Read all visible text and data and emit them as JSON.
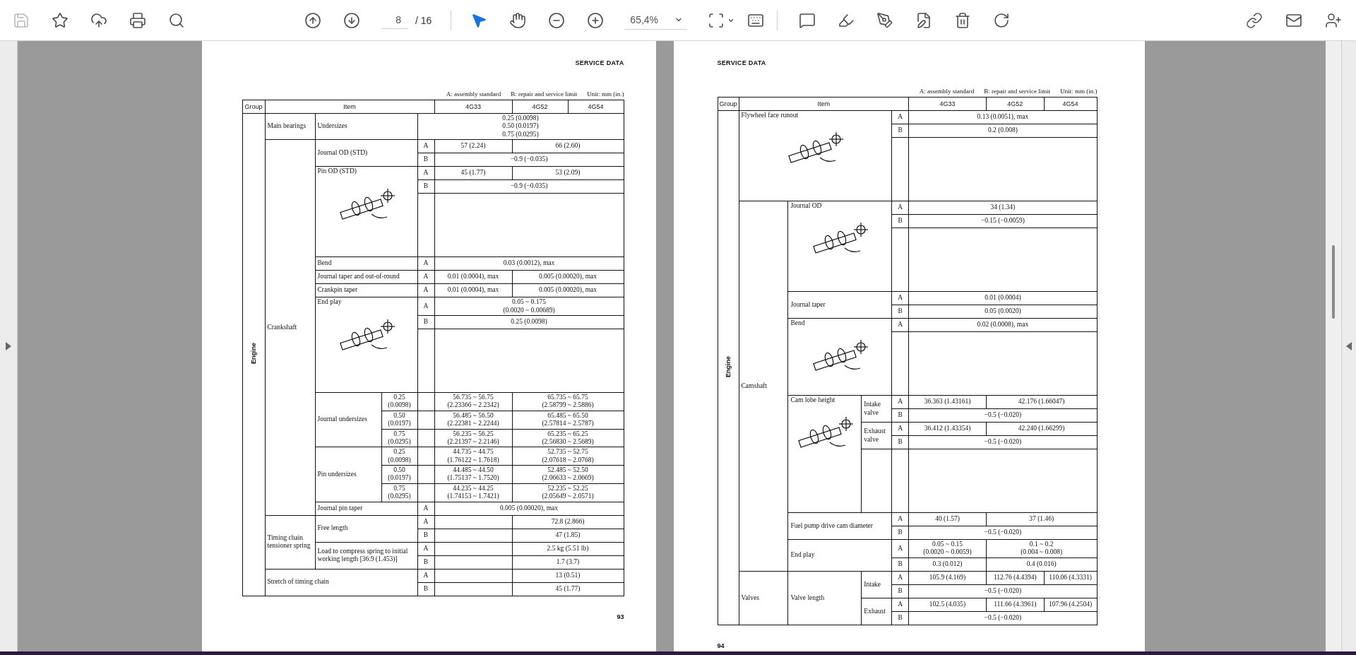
{
  "toolbar": {
    "file_tools": [
      {
        "kind": "save",
        "disabled": true
      },
      {
        "kind": "star",
        "disabled": false
      },
      {
        "kind": "upload",
        "disabled": false
      },
      {
        "kind": "print",
        "disabled": false
      },
      {
        "kind": "search",
        "disabled": false
      }
    ],
    "page_input": "8",
    "page_count": "/ 16",
    "modes": [
      {
        "kind": "pointer",
        "selected": true
      },
      {
        "kind": "hand",
        "selected": false
      }
    ],
    "zoom": "65,4%"
  },
  "pages": [
    {
      "kind": "verso",
      "header": "SERVICE DATA",
      "legend": [
        "A: assembly standard",
        "B: repair and service limit",
        "Unit: mm (in.)"
      ],
      "page_number": "93",
      "table": [
        {
          "kind": "line",
          "cells": [
            {
              "kind": "header",
              "text": "Group"
            },
            {
              "kind": "header",
              "text": "Item",
              "colspan": 4
            },
            {
              "kind": "header",
              "text": "4G33"
            },
            {
              "kind": "header",
              "text": "4G52"
            },
            {
              "kind": "header",
              "text": "4G54"
            }
          ]
        },
        {
          "kind": "line",
          "cells": [
            {
              "kind": "group",
              "text": "Engine",
              "rowspan": 25
            },
            {
              "kind": "section",
              "text": "Main bearings"
            },
            {
              "kind": "label",
              "text": "Undersizes",
              "colspan": 2
            },
            {
              "kind": "value",
              "text": "0.25 (0.0098)\n0.50 (0.0197)\n0.75 (0.0295)",
              "colspan": 4
            }
          ]
        },
        {
          "kind": "line",
          "cells": [
            {
              "kind": "section",
              "text": "Crankshaft",
              "rowspan": 18
            },
            {
              "kind": "label",
              "text": "Journal OD (STD)",
              "colspan": 2,
              "rowspan": 2
            },
            {
              "kind": "ab",
              "text": "A"
            },
            {
              "kind": "value",
              "text": "57 (2.24)"
            },
            {
              "kind": "value",
              "text": "66 (2.60)",
              "colspan": 2
            }
          ]
        },
        {
          "kind": "line",
          "cells": [
            {
              "kind": "ab",
              "text": "B"
            },
            {
              "kind": "value",
              "text": "−0.9 (−0.035)",
              "colspan": 3
            }
          ]
        },
        {
          "kind": "line",
          "cells": [
            {
              "kind": "label",
              "text": "Pin OD (STD)",
              "colspan": 2,
              "rowspan": 3,
              "figure": true
            },
            {
              "kind": "ab",
              "text": "A"
            },
            {
              "kind": "value",
              "text": "45 (1.77)"
            },
            {
              "kind": "value",
              "text": "53 (2.09)",
              "colspan": 2
            }
          ]
        },
        {
          "kind": "line",
          "cells": [
            {
              "kind": "ab",
              "text": "B"
            },
            {
              "kind": "value",
              "text": "−0.9 (−0.035)",
              "colspan": 3
            }
          ]
        },
        {
          "kind": "gap",
          "cells": [
            {
              "kind": "empty"
            },
            {
              "kind": "empty",
              "colspan": 3
            }
          ]
        },
        {
          "kind": "line",
          "cells": [
            {
              "kind": "label",
              "text": "Bend",
              "colspan": 2
            },
            {
              "kind": "ab",
              "text": "A"
            },
            {
              "kind": "value",
              "text": "0.03 (0.0012), max",
              "colspan": 3
            }
          ]
        },
        {
          "kind": "line",
          "cells": [
            {
              "kind": "label",
              "text": "Journal taper and out-of-round",
              "colspan": 2
            },
            {
              "kind": "ab",
              "text": "A"
            },
            {
              "kind": "value",
              "text": "0.01 (0.0004), max"
            },
            {
              "kind": "value",
              "text": "0.005 (0.00020), max",
              "colspan": 2
            }
          ]
        },
        {
          "kind": "line",
          "cells": [
            {
              "kind": "label",
              "text": "Crankpin taper",
              "colspan": 2
            },
            {
              "kind": "ab",
              "text": "A"
            },
            {
              "kind": "value",
              "text": "0.01 (0.0004), max"
            },
            {
              "kind": "value",
              "text": "0.005 (0.00020), max",
              "colspan": 2
            }
          ]
        },
        {
          "kind": "line",
          "cells": [
            {
              "kind": "label",
              "text": "End play",
              "colspan": 2,
              "rowspan": 3,
              "figure": true
            },
            {
              "kind": "ab",
              "text": "A"
            },
            {
              "kind": "value",
              "text": "0.05 ~ 0.175\n(0.0020 ~ 0.00689)",
              "colspan": 3
            }
          ]
        },
        {
          "kind": "line",
          "cells": [
            {
              "kind": "ab",
              "text": "B"
            },
            {
              "kind": "value",
              "text": "0.25 (0.0098)",
              "colspan": 3
            }
          ]
        },
        {
          "kind": "gap",
          "cells": [
            {
              "kind": "empty"
            },
            {
              "kind": "empty",
              "colspan": 3
            }
          ]
        },
        {
          "kind": "line",
          "cells": [
            {
              "kind": "label",
              "text": "Journal undersizes",
              "rowspan": 3
            },
            {
              "kind": "size",
              "text": "0.25\n(0.0098)"
            },
            {
              "kind": "empty"
            },
            {
              "kind": "value",
              "text": "56.735 ~ 56.75\n(2.23366 ~ 2.2342)"
            },
            {
              "kind": "value",
              "text": "65.735 ~ 65.75\n(2.58799 ~ 2.5886)",
              "colspan": 2
            }
          ]
        },
        {
          "kind": "line",
          "cells": [
            {
              "kind": "size",
              "text": "0.50\n(0.0197)"
            },
            {
              "kind": "empty"
            },
            {
              "kind": "value",
              "text": "56.485 ~ 56.50\n(2.22381 ~ 2.2244)"
            },
            {
              "kind": "value",
              "text": "65.485 ~ 65.50\n(2.57814 ~ 2.5787)",
              "colspan": 2
            }
          ]
        },
        {
          "kind": "line",
          "cells": [
            {
              "kind": "size",
              "text": "0.75\n(0.0295)"
            },
            {
              "kind": "empty"
            },
            {
              "kind": "value",
              "text": "56.235 ~ 56.25\n(2.21397 ~ 2.2146)"
            },
            {
              "kind": "value",
              "text": "65.235 ~ 65.25\n(2.56830 ~ 2.5689)",
              "colspan": 2
            }
          ]
        },
        {
          "kind": "line",
          "cells": [
            {
              "kind": "label",
              "text": "Pin undersizes",
              "rowspan": 3
            },
            {
              "kind": "size",
              "text": "0.25\n(0.0098)"
            },
            {
              "kind": "empty"
            },
            {
              "kind": "value",
              "text": "44.735 ~ 44.75\n(1.76122 ~ 1.7618)"
            },
            {
              "kind": "value",
              "text": "52.735 ~ 52.75\n(2.07618 ~ 2.0768)",
              "colspan": 2
            }
          ]
        },
        {
          "kind": "line",
          "cells": [
            {
              "kind": "size",
              "text": "0.50\n(0.0197)"
            },
            {
              "kind": "empty"
            },
            {
              "kind": "value",
              "text": "44.485 ~ 44.50\n(1.75137 ~ 1.7520)"
            },
            {
              "kind": "value",
              "text": "52.485 ~ 52.50\n(2.06633 ~ 2.0669)",
              "colspan": 2
            }
          ]
        },
        {
          "kind": "line",
          "cells": [
            {
              "kind": "size",
              "text": "0.75\n(0.0295)"
            },
            {
              "kind": "empty"
            },
            {
              "kind": "value",
              "text": "44.235 ~ 44.25\n(1.74153 ~ 1.7421)"
            },
            {
              "kind": "value",
              "text": "52.235 ~ 52.25\n(2.05649 ~ 2.0571)",
              "colspan": 2
            }
          ]
        },
        {
          "kind": "line",
          "cells": [
            {
              "kind": "label",
              "text": "Journal pin taper",
              "colspan": 2
            },
            {
              "kind": "ab",
              "text": "A"
            },
            {
              "kind": "value",
              "text": "0.005 (0.00020), max",
              "colspan": 3
            }
          ]
        },
        {
          "kind": "line",
          "cells": [
            {
              "kind": "section",
              "text": "Timing chain tensioner spring",
              "rowspan": 4
            },
            {
              "kind": "label",
              "text": "Free length",
              "colspan": 2,
              "rowspan": 2
            },
            {
              "kind": "ab",
              "text": "A"
            },
            {
              "kind": "empty"
            },
            {
              "kind": "value",
              "text": "72.8 (2.866)",
              "colspan": 2
            }
          ]
        },
        {
          "kind": "line",
          "cells": [
            {
              "kind": "ab",
              "text": "B"
            },
            {
              "kind": "empty"
            },
            {
              "kind": "value",
              "text": "47 (1.85)",
              "colspan": 2
            }
          ]
        },
        {
          "kind": "line",
          "cells": [
            {
              "kind": "label",
              "text": "Load to compress spring to initial working length [36.9 (1.453)]",
              "colspan": 2,
              "rowspan": 2
            },
            {
              "kind": "ab",
              "text": "A"
            },
            {
              "kind": "empty"
            },
            {
              "kind": "value",
              "text": "2.5 kg (5.51 lb)",
              "colspan": 2
            }
          ]
        },
        {
          "kind": "line",
          "cells": [
            {
              "kind": "ab",
              "text": "B"
            },
            {
              "kind": "empty"
            },
            {
              "kind": "value",
              "text": "1.7 (3.7)",
              "colspan": 2
            }
          ]
        },
        {
          "kind": "line",
          "cells": [
            {
              "kind": "section",
              "text": "Stretch of timing chain",
              "colspan": 3,
              "rowspan": 2
            },
            {
              "kind": "ab",
              "text": "A"
            },
            {
              "kind": "empty"
            },
            {
              "kind": "value",
              "text": "13 (0.51)",
              "colspan": 2
            }
          ]
        },
        {
          "kind": "line",
          "cells": [
            {
              "kind": "ab",
              "text": "B"
            },
            {
              "kind": "empty"
            },
            {
              "kind": "value",
              "text": "45 (1.77)",
              "colspan": 2
            }
          ]
        }
      ]
    },
    {
      "kind": "recto",
      "header": "SERVICE DATA",
      "legend": [
        "A: assembly standard",
        "B: repair and service limit",
        "Unit: mm (in.)"
      ],
      "page_number": "94",
      "table": [
        {
          "kind": "line",
          "cells": [
            {
              "kind": "header",
              "text": "Group"
            },
            {
              "kind": "header",
              "text": "Item",
              "colspan": 4
            },
            {
              "kind": "header",
              "text": "4G33"
            },
            {
              "kind": "header",
              "text": "4G52"
            },
            {
              "kind": "header",
              "text": "4G54"
            }
          ]
        },
        {
          "kind": "line",
          "cells": [
            {
              "kind": "group",
              "text": "Engine",
              "rowspan": 23
            },
            {
              "kind": "label",
              "text": "Flywheel face runout",
              "colspan": 3,
              "rowspan": 3,
              "figure": true
            },
            {
              "kind": "ab",
              "text": "A"
            },
            {
              "kind": "value",
              "text": "0.13 (0.0051), max",
              "colspan": 3
            }
          ]
        },
        {
          "kind": "line",
          "cells": [
            {
              "kind": "ab",
              "text": "B"
            },
            {
              "kind": "value",
              "text": "0.2 (0.008)",
              "colspan": 3
            }
          ]
        },
        {
          "kind": "gap",
          "cells": [
            {
              "kind": "empty"
            },
            {
              "kind": "empty",
              "colspan": 3
            }
          ]
        },
        {
          "kind": "line",
          "cells": [
            {
              "kind": "section",
              "text": "Camshaft",
              "rowspan": 16
            },
            {
              "kind": "label",
              "text": "Journal OD",
              "colspan": 2,
              "rowspan": 3,
              "figure": true
            },
            {
              "kind": "ab",
              "text": "A"
            },
            {
              "kind": "value",
              "text": "34 (1.34)",
              "colspan": 3
            }
          ]
        },
        {
          "kind": "line",
          "cells": [
            {
              "kind": "ab",
              "text": "B"
            },
            {
              "kind": "value",
              "text": "−0.15 (−0.0059)",
              "colspan": 3
            }
          ]
        },
        {
          "kind": "gap",
          "cells": [
            {
              "kind": "empty"
            },
            {
              "kind": "empty",
              "colspan": 3
            }
          ]
        },
        {
          "kind": "line",
          "cells": [
            {
              "kind": "label",
              "text": "Journal taper",
              "colspan": 2,
              "rowspan": 2
            },
            {
              "kind": "ab",
              "text": "A"
            },
            {
              "kind": "value",
              "text": "0.01 (0.0004)",
              "colspan": 3
            }
          ]
        },
        {
          "kind": "line",
          "cells": [
            {
              "kind": "ab",
              "text": "B"
            },
            {
              "kind": "value",
              "text": "0.05 (0.0020)",
              "colspan": 3
            }
          ]
        },
        {
          "kind": "line",
          "cells": [
            {
              "kind": "label",
              "text": "Bend",
              "colspan": 2,
              "rowspan": 2,
              "figure": true
            },
            {
              "kind": "ab",
              "text": "A"
            },
            {
              "kind": "value",
              "text": "0.02 (0.0008), max",
              "colspan": 3
            }
          ]
        },
        {
          "kind": "gap",
          "cells": [
            {
              "kind": "empty"
            },
            {
              "kind": "empty",
              "colspan": 3
            }
          ]
        },
        {
          "kind": "line",
          "cells": [
            {
              "kind": "label",
              "text": "Cam lobe height",
              "rowspan": 5,
              "figure": true
            },
            {
              "kind": "label",
              "text": "Intake valve",
              "rowspan": 2
            },
            {
              "kind": "ab",
              "text": "A"
            },
            {
              "kind": "value",
              "text": "36.363 (1.43161)"
            },
            {
              "kind": "value",
              "text": "42.176 (1.66047)",
              "colspan": 2
            }
          ]
        },
        {
          "kind": "line",
          "cells": [
            {
              "kind": "ab",
              "text": "B"
            },
            {
              "kind": "value",
              "text": "−0.5 (−0.020)",
              "colspan": 3
            }
          ]
        },
        {
          "kind": "line",
          "cells": [
            {
              "kind": "label",
              "text": "Exhaust valve",
              "rowspan": 2
            },
            {
              "kind": "ab",
              "text": "A"
            },
            {
              "kind": "value",
              "text": "36.412 (1.43354)"
            },
            {
              "kind": "value",
              "text": "42.240 (1.66299)",
              "colspan": 2
            }
          ]
        },
        {
          "kind": "line",
          "cells": [
            {
              "kind": "ab",
              "text": "B"
            },
            {
              "kind": "value",
              "text": "−0.5 (−0.020)",
              "colspan": 3
            }
          ]
        },
        {
          "kind": "gap",
          "cells": [
            {
              "kind": "empty"
            },
            {
              "kind": "empty"
            },
            {
              "kind": "empty",
              "colspan": 3
            }
          ]
        },
        {
          "kind": "line",
          "cells": [
            {
              "kind": "label",
              "text": "Fuel pump drive cam diameter",
              "colspan": 2,
              "rowspan": 2
            },
            {
              "kind": "ab",
              "text": "A"
            },
            {
              "kind": "value",
              "text": "40 (1.57)"
            },
            {
              "kind": "value",
              "text": "37 (1.46)",
              "colspan": 2
            }
          ]
        },
        {
          "kind": "line",
          "cells": [
            {
              "kind": "ab",
              "text": "B"
            },
            {
              "kind": "value",
              "text": "−0.5 (−0.020)",
              "colspan": 3
            }
          ]
        },
        {
          "kind": "line",
          "cells": [
            {
              "kind": "label",
              "text": "End play",
              "colspan": 2,
              "rowspan": 2
            },
            {
              "kind": "ab",
              "text": "A"
            },
            {
              "kind": "value",
              "text": "0.05 ~ 0.15\n(0.0020 ~ 0.0059)"
            },
            {
              "kind": "value",
              "text": "0.1 ~ 0.2\n(0.004 ~ 0.008)",
              "colspan": 2
            }
          ]
        },
        {
          "kind": "line",
          "cells": [
            {
              "kind": "ab",
              "text": "B"
            },
            {
              "kind": "value",
              "text": "0.3 (0.012)"
            },
            {
              "kind": "value",
              "text": "0.4 (0.016)",
              "colspan": 2
            }
          ]
        },
        {
          "kind": "line",
          "cells": [
            {
              "kind": "section",
              "text": "Valves",
              "rowspan": 4
            },
            {
              "kind": "label",
              "text": "Valve length",
              "rowspan": 4
            },
            {
              "kind": "label",
              "text": "Intake",
              "rowspan": 2
            },
            {
              "kind": "ab",
              "text": "A"
            },
            {
              "kind": "value",
              "text": "105.9 (4.169)"
            },
            {
              "kind": "value",
              "text": "112.76 (4.4394)"
            },
            {
              "kind": "value",
              "text": "110.06 (4.3331)"
            }
          ]
        },
        {
          "kind": "line",
          "cells": [
            {
              "kind": "ab",
              "text": "B"
            },
            {
              "kind": "value",
              "text": "−0.5 (−0.020)",
              "colspan": 3
            }
          ]
        },
        {
          "kind": "line",
          "cells": [
            {
              "kind": "label",
              "text": "Exhaust",
              "rowspan": 2
            },
            {
              "kind": "ab",
              "text": "A"
            },
            {
              "kind": "value",
              "text": "102.5 (4.035)"
            },
            {
              "kind": "value",
              "text": "111.66 (4.3961)"
            },
            {
              "kind": "value",
              "text": "107.96 (4.2504)"
            }
          ]
        },
        {
          "kind": "line",
          "cells": [
            {
              "kind": "ab",
              "text": "B"
            },
            {
              "kind": "value",
              "text": "−0.5 (−0.020)",
              "colspan": 3
            }
          ]
        }
      ]
    }
  ]
}
